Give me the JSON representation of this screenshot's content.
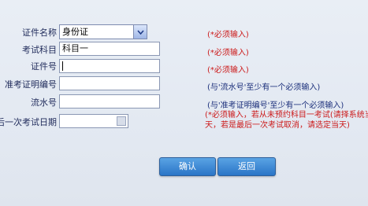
{
  "form": {
    "id_type": {
      "label": "证件名称",
      "value": "身份证",
      "required": "(*必须输入)"
    },
    "subject": {
      "label": "考试科目",
      "value": "科目一",
      "required": "(*必须输入)"
    },
    "id_number": {
      "label": "证件号",
      "value": "",
      "required": "(*必须输入)"
    },
    "exam_cert": {
      "label": "准考证明编号",
      "value": "",
      "hint": "(与'流水号'至少有一个必须输入)"
    },
    "serial": {
      "label": "流水号",
      "value": "",
      "hint": "(与'准考证明编号'至少有一个必须输入)"
    },
    "last_date": {
      "label": "最后一次考试日期",
      "value": "",
      "warning_line1": "(*必须输入，若从未预约科目一考试(请择系统当",
      "warning_line2": "天，若是最后一次考试取消，请选定当天)"
    }
  },
  "buttons": {
    "confirm": "确认",
    "back": "返回"
  },
  "icons": {
    "dropdown": "chevron-down-icon",
    "calendar": "calendar-icon"
  }
}
